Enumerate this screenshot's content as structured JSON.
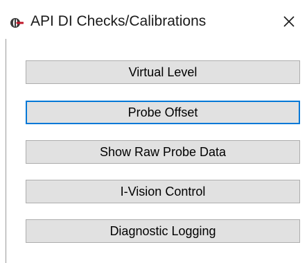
{
  "window": {
    "title": "API DI Checks/Calibrations",
    "app_icon": "api-logo-icon",
    "close_icon": "close-icon"
  },
  "buttons": [
    {
      "label": "Virtual Level",
      "focused": false
    },
    {
      "label": "Probe Offset",
      "focused": true
    },
    {
      "label": "Show Raw Probe Data",
      "focused": false
    },
    {
      "label": "I-Vision Control",
      "focused": false
    },
    {
      "label": "Diagnostic Logging",
      "focused": false
    }
  ],
  "colors": {
    "button_face": "#e1e1e1",
    "button_border": "#adadad",
    "focus_border": "#0078d7"
  }
}
